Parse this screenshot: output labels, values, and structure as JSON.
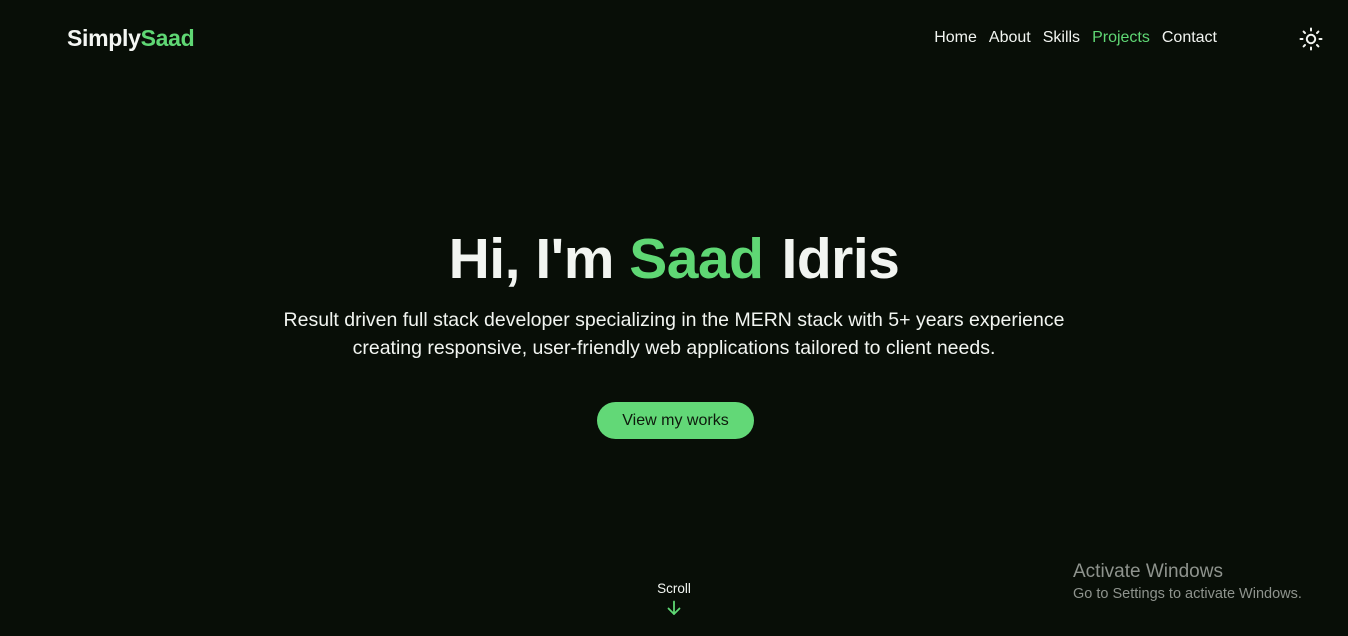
{
  "brand": {
    "name_first": "Simply",
    "name_second": "Saad",
    "accent_color": "#5fd774",
    "background_color": "#080e07"
  },
  "nav": {
    "items": [
      {
        "label": "Home",
        "active": false
      },
      {
        "label": "About",
        "active": false
      },
      {
        "label": "Skills",
        "active": false
      },
      {
        "label": "Projects",
        "active": true
      },
      {
        "label": "Contact",
        "active": false
      }
    ],
    "theme_toggle_icon": "sun-icon"
  },
  "hero": {
    "greeting": "Hi, I'm",
    "first_name": "Saad",
    "last_name": "Idris",
    "description": "Result driven full stack developer specializing in the MERN stack with 5+ years experience creating responsive, user-friendly web applications tailored to client needs.",
    "cta_label": "View my works"
  },
  "scroll": {
    "label": "Scroll",
    "icon": "arrow-down-icon"
  },
  "windows_watermark": {
    "title": "Activate Windows",
    "subtitle": "Go to Settings to activate Windows."
  }
}
